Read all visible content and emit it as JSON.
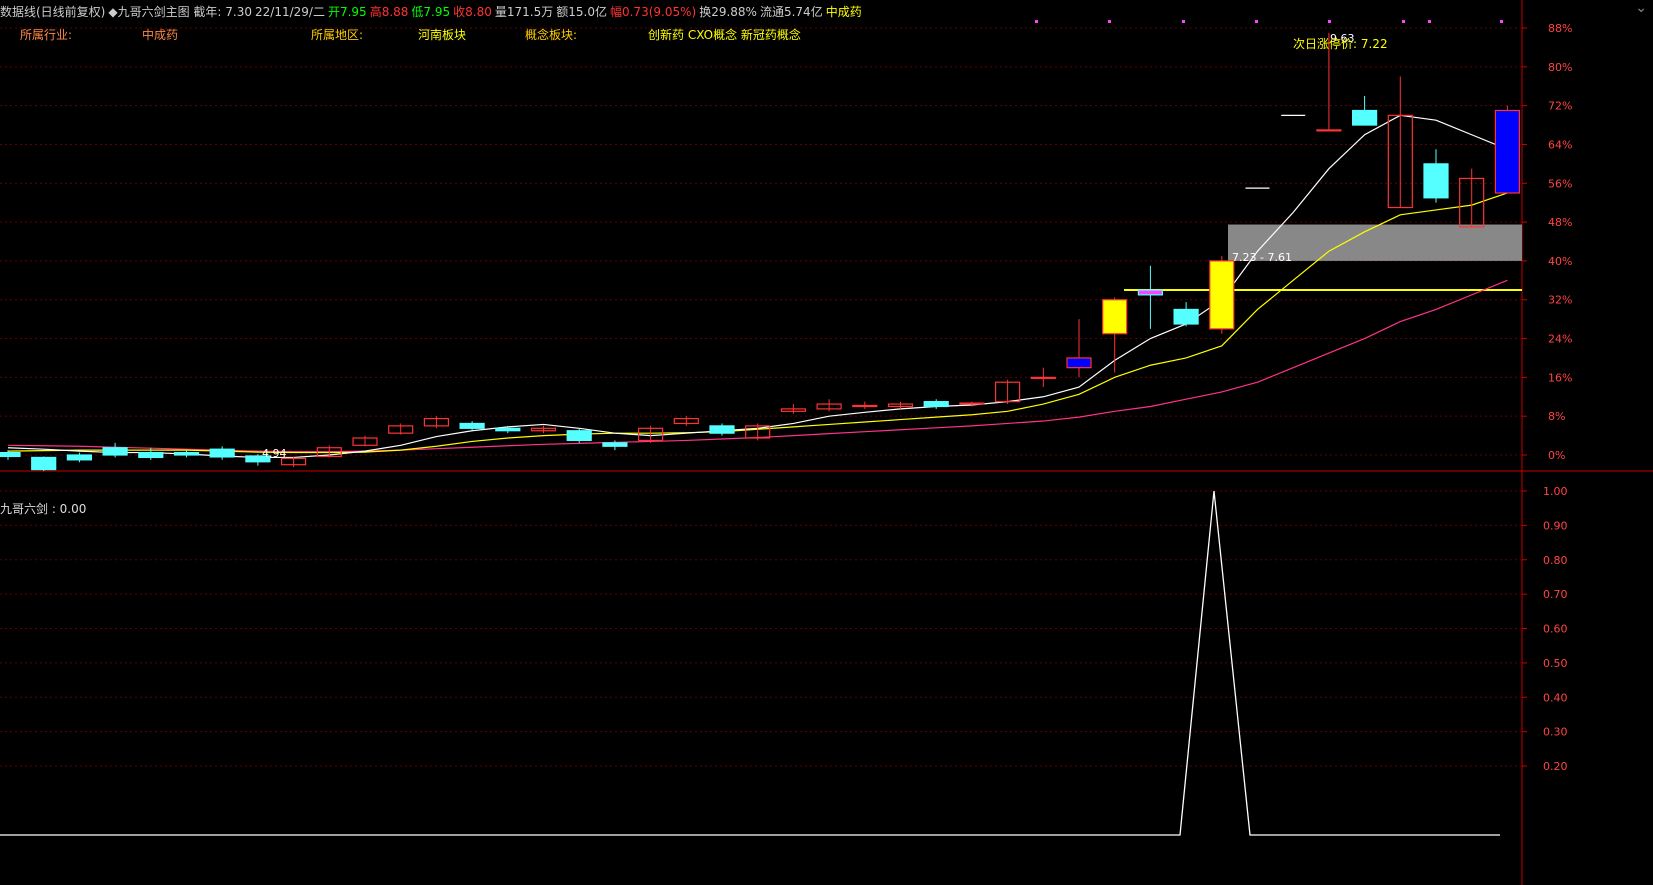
{
  "header": {
    "line1": [
      {
        "text": "数据线(日线前复权)",
        "color": "#cccccc"
      },
      {
        "text": "◆九哥六剑主图 截年: 7.30",
        "color": "#cccccc"
      },
      {
        "text": "22/11/29/二",
        "color": "#cccccc"
      },
      {
        "text": "开7.95",
        "color": "#00ff00"
      },
      {
        "text": "高8.88",
        "color": "#ff3333"
      },
      {
        "text": "低7.95",
        "color": "#00ff00"
      },
      {
        "text": "收8.80",
        "color": "#ff3333"
      },
      {
        "text": "量171.5万",
        "color": "#cccccc"
      },
      {
        "text": "额15.0亿",
        "color": "#cccccc"
      },
      {
        "text": "幅0.73(9.05%)",
        "color": "#ff3333"
      },
      {
        "text": "换29.88%",
        "color": "#cccccc"
      },
      {
        "text": "流通5.74亿",
        "color": "#cccccc"
      },
      {
        "text": "中成药",
        "color": "#ffff00"
      }
    ],
    "industry_label": "所属行业:",
    "industry_value": "中成药",
    "region_label": "所属地区:",
    "region_value": "河南板块",
    "concept_label": "概念板块:",
    "concept_value": "创新药 CXO概念 新冠药概念"
  },
  "indicator": {
    "label": "九哥六剑 : 0.00",
    "ticks": [
      "1.00",
      "0.90",
      "0.80",
      "0.70",
      "0.60",
      "0.50",
      "0.40",
      "0.30",
      "0.20"
    ]
  },
  "colors": {
    "up": "#ff3333",
    "down": "#55ffff",
    "ma5": "#ffffff",
    "ma10": "#ffff00",
    "ma30": "#ff3388",
    "axis": "#cc0000",
    "grid": "#660000",
    "resist_band": "#888888",
    "support": "#ffff00"
  },
  "chart_data": {
    "type": "candlestick",
    "y_axis_ticks": [
      "88%",
      "80%",
      "72%",
      "64%",
      "56%",
      "48%",
      "40%",
      "32%",
      "24%",
      "16%",
      "8%",
      "0%"
    ],
    "y_range_percent": [
      0,
      88
    ],
    "base_price": 4.94,
    "low_label": "4.94",
    "high_label": "9.63",
    "limit_up_label": "次日涨停价: 7.22",
    "band_label": "7.23 - 7.61",
    "candles": [
      {
        "o": 0.5,
        "c": -0.3,
        "h": 1.0,
        "l": -1.0
      },
      {
        "o": -0.5,
        "c": -3.0,
        "h": -0.3,
        "l": -3.3
      },
      {
        "o": 0.0,
        "c": -1.0,
        "h": 0.5,
        "l": -1.5
      },
      {
        "o": 1.5,
        "c": 0.0,
        "h": 2.5,
        "l": -0.5
      },
      {
        "o": 0.5,
        "c": -0.5,
        "h": 1.5,
        "l": -1.0
      },
      {
        "o": 0.5,
        "c": 0.0,
        "h": 1.0,
        "l": -0.5
      },
      {
        "o": 1.2,
        "c": -0.4,
        "h": 1.8,
        "l": -1.0
      },
      {
        "o": -0.2,
        "c": -1.4,
        "h": 0.2,
        "l": -2.2
      },
      {
        "o": -2.0,
        "c": -0.7,
        "h": -0.3,
        "l": -2.5
      },
      {
        "o": -0.3,
        "c": 1.5,
        "h": 2.0,
        "l": -0.5
      },
      {
        "o": 2.0,
        "c": 3.5,
        "h": 4.0,
        "l": 1.8
      },
      {
        "o": 4.5,
        "c": 6.0,
        "h": 6.5,
        "l": 4.2
      },
      {
        "o": 6.0,
        "c": 7.5,
        "h": 8.0,
        "l": 5.5
      },
      {
        "o": 6.5,
        "c": 5.5,
        "h": 7.0,
        "l": 5.0
      },
      {
        "o": 5.5,
        "c": 5.0,
        "h": 6.0,
        "l": 4.5
      },
      {
        "o": 5.0,
        "c": 5.5,
        "h": 6.0,
        "l": 4.5
      },
      {
        "o": 5.0,
        "c": 3.0,
        "h": 5.5,
        "l": 2.5
      },
      {
        "o": 2.5,
        "c": 1.8,
        "h": 3.0,
        "l": 1.0
      },
      {
        "o": 3.0,
        "c": 5.5,
        "h": 6.0,
        "l": 2.5
      },
      {
        "o": 6.5,
        "c": 7.5,
        "h": 8.0,
        "l": 6.0
      },
      {
        "o": 6.0,
        "c": 4.5,
        "h": 6.5,
        "l": 4.0
      },
      {
        "o": 3.5,
        "c": 6.0,
        "h": 6.5,
        "l": 3.0
      },
      {
        "o": 9.0,
        "c": 9.5,
        "h": 10.5,
        "l": 8.5
      },
      {
        "o": 9.5,
        "c": 10.5,
        "h": 11.5,
        "l": 9.0
      },
      {
        "o": 10.0,
        "c": 10.2,
        "h": 11.0,
        "l": 9.5
      },
      {
        "o": 10.0,
        "c": 10.5,
        "h": 11.0,
        "l": 9.5
      },
      {
        "o": 11.0,
        "c": 10.0,
        "h": 11.5,
        "l": 9.5
      },
      {
        "o": 10.5,
        "c": 10.7,
        "h": 11.0,
        "l": 10.0
      },
      {
        "o": 11.0,
        "c": 15.0,
        "h": 15.5,
        "l": 10.5
      },
      {
        "o": 16.0,
        "c": 16.0,
        "h": 18.0,
        "l": 14.0
      },
      {
        "o": 18.0,
        "c": 20.0,
        "h": 28.0,
        "l": 16.0
      },
      {
        "o": 25.0,
        "c": 32.0,
        "h": 32.5,
        "l": 17.0
      },
      {
        "o": 33.0,
        "c": 34.0,
        "h": 39.0,
        "l": 26.0
      },
      {
        "o": 30.0,
        "c": 27.0,
        "h": 31.5,
        "l": 26.5
      },
      {
        "o": 26.0,
        "c": 40.0,
        "h": 41.0,
        "l": 25.0
      },
      {
        "o": 55.0,
        "c": 55.0,
        "h": 55.0,
        "l": 55.0
      },
      {
        "o": 70.0,
        "c": 70.0,
        "h": 70.0,
        "l": 70.0
      },
      {
        "o": 67.0,
        "c": 67.0,
        "h": 87.0,
        "l": 67.0
      },
      {
        "o": 71.0,
        "c": 68.0,
        "h": 74.0,
        "l": 68.0
      },
      {
        "o": 51.0,
        "c": 70.0,
        "h": 78.0,
        "l": 51.0
      },
      {
        "o": 60.0,
        "c": 53.0,
        "h": 63.0,
        "l": 52.0
      },
      {
        "o": 47.0,
        "c": 57.0,
        "h": 59.0,
        "l": 47.0
      },
      {
        "o": 71.0,
        "c": 54.0,
        "h": 72.0,
        "l": 54.0
      }
    ],
    "ma5": [
      1.5,
      1.2,
      0.8,
      0.5,
      0.5,
      0.2,
      -0.2,
      -0.5,
      -0.5,
      0.0,
      0.8,
      2.0,
      3.8,
      5.0,
      5.8,
      6.3,
      5.5,
      4.5,
      4.0,
      4.5,
      5.0,
      5.5,
      6.5,
      8.0,
      8.8,
      9.5,
      10.0,
      10.3,
      11.0,
      12.0,
      14.0,
      19.5,
      24.0,
      27.0,
      32.0,
      42.0,
      50.0,
      59.0,
      66.0,
      70.0,
      69.0,
      66.0,
      63.0
    ],
    "ma10": [
      0.8,
      0.9,
      1.0,
      1.0,
      1.0,
      1.0,
      0.8,
      0.6,
      0.5,
      0.5,
      0.6,
      1.0,
      1.8,
      2.8,
      3.5,
      4.0,
      4.3,
      4.5,
      4.5,
      4.6,
      4.8,
      5.3,
      5.8,
      6.3,
      6.8,
      7.3,
      7.8,
      8.3,
      9.0,
      10.5,
      12.5,
      16.0,
      18.5,
      20.0,
      22.5,
      30.0,
      36.0,
      42.0,
      46.0,
      49.5,
      50.5,
      51.5,
      54.0
    ],
    "ma30": [
      2.0,
      1.9,
      1.8,
      1.6,
      1.4,
      1.2,
      1.0,
      0.8,
      0.7,
      0.7,
      0.8,
      1.0,
      1.3,
      1.6,
      1.9,
      2.2,
      2.4,
      2.6,
      2.8,
      3.0,
      3.3,
      3.6,
      4.0,
      4.4,
      4.8,
      5.2,
      5.6,
      6.0,
      6.5,
      7.0,
      7.8,
      9.0,
      10.0,
      11.5,
      13.0,
      15.0,
      18.0,
      21.0,
      24.0,
      27.5,
      30.0,
      33.0,
      36.0
    ],
    "resist_band": [
      40,
      47.5
    ],
    "support_line": 34,
    "indicator": {
      "spike_value": 1.0,
      "spike_index": 34,
      "y_range": [
        0.1,
        1.0
      ]
    }
  }
}
